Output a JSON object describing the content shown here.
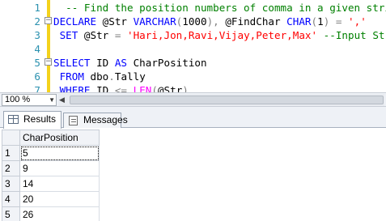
{
  "editor": {
    "lines": [
      {
        "num": "1",
        "parts": [
          {
            "t": "  -- Find the position numbers of comma in a given string.",
            "c": "cm"
          }
        ]
      },
      {
        "num": "2",
        "parts": [
          {
            "t": "DECLARE",
            "c": "kw"
          },
          {
            "t": " @Str ",
            "c": "tx"
          },
          {
            "t": "VARCHAR",
            "c": "kw"
          },
          {
            "t": "(",
            "c": "gr"
          },
          {
            "t": "1000",
            "c": "tx"
          },
          {
            "t": "),",
            "c": "gr"
          },
          {
            "t": " @FindChar ",
            "c": "tx"
          },
          {
            "t": "CHAR",
            "c": "kw"
          },
          {
            "t": "(",
            "c": "gr"
          },
          {
            "t": "1",
            "c": "tx"
          },
          {
            "t": ")",
            "c": "gr"
          },
          {
            "t": " = ",
            "c": "gr"
          },
          {
            "t": "','",
            "c": "st"
          }
        ]
      },
      {
        "num": "3",
        "parts": [
          {
            "t": " SET",
            "c": "kw"
          },
          {
            "t": " @Str ",
            "c": "tx"
          },
          {
            "t": "=",
            "c": "gr"
          },
          {
            "t": " 'Hari,Jon,Ravi,Vijay,Peter,Max'",
            "c": "st"
          },
          {
            "t": " --Input String",
            "c": "cm"
          }
        ]
      },
      {
        "num": "4",
        "parts": []
      },
      {
        "num": "5",
        "parts": [
          {
            "t": "SELECT",
            "c": "kw"
          },
          {
            "t": " ID ",
            "c": "tx"
          },
          {
            "t": "AS",
            "c": "kw"
          },
          {
            "t": " CharPosition",
            "c": "tx"
          }
        ]
      },
      {
        "num": "6",
        "parts": [
          {
            "t": " FROM",
            "c": "kw"
          },
          {
            "t": " dbo",
            "c": "tx"
          },
          {
            "t": ".",
            "c": "gr"
          },
          {
            "t": "Tally",
            "c": "tx"
          }
        ]
      },
      {
        "num": "7",
        "parts": [
          {
            "t": " WHERE",
            "c": "kw"
          },
          {
            "t": " ID ",
            "c": "tx"
          },
          {
            "t": "<=",
            "c": "gr"
          },
          {
            "t": " ",
            "c": "tx"
          },
          {
            "t": "LEN",
            "c": "fn"
          },
          {
            "t": "(",
            "c": "gr"
          },
          {
            "t": "@Str",
            "c": "tx"
          },
          {
            "t": ")",
            "c": "gr"
          }
        ]
      }
    ]
  },
  "statusbar": {
    "zoom_value": "100 %"
  },
  "tabs": {
    "results_label": "Results",
    "messages_label": "Messages"
  },
  "grid": {
    "column_header": "CharPosition",
    "rows": [
      {
        "num": "1",
        "value": "5"
      },
      {
        "num": "2",
        "value": "9"
      },
      {
        "num": "3",
        "value": "14"
      },
      {
        "num": "4",
        "value": "20"
      },
      {
        "num": "5",
        "value": "26"
      }
    ]
  }
}
